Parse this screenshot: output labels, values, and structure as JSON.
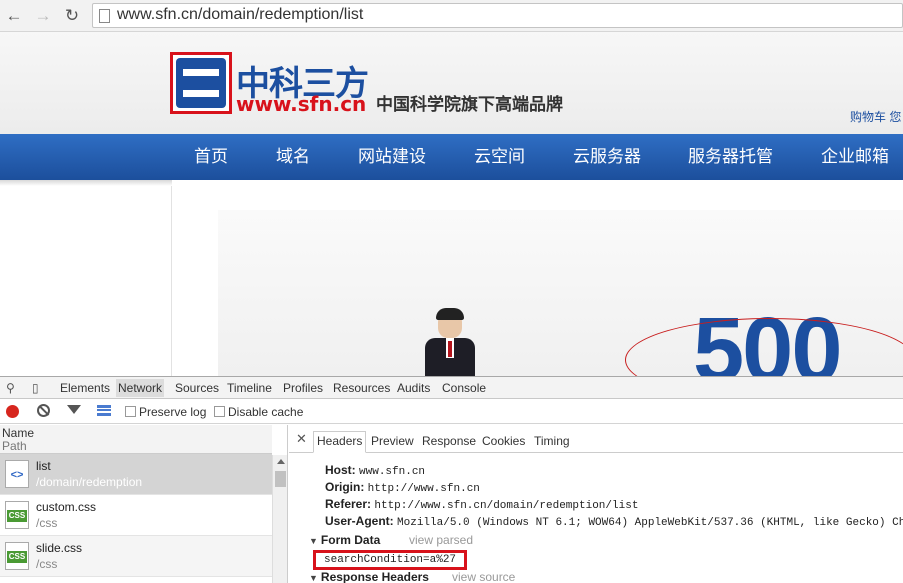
{
  "browser": {
    "url": "www.sfn.cn/domain/redemption/list"
  },
  "site": {
    "logo_text_cn": "中科三方",
    "logo_url": "www.sfn.cn",
    "slogan": "中国科学院旗下高端品牌",
    "cart_link": "购物车 您",
    "nav": [
      "首页",
      "域名",
      "网站建设",
      "云空间",
      "云服务器",
      "服务器托管",
      "企业邮箱"
    ],
    "banner_text": "500",
    "brand_colors": {
      "blue": "#1c4fa0",
      "red": "#d8121b"
    }
  },
  "devtools": {
    "tabs": [
      "Elements",
      "Network",
      "Sources",
      "Timeline",
      "Profiles",
      "Resources",
      "Audits",
      "Console"
    ],
    "active_tab": "Network",
    "toolbar": {
      "preserve_log": "Preserve log",
      "disable_cache": "Disable cache"
    },
    "list_header": {
      "name": "Name",
      "path": "Path"
    },
    "requests": [
      {
        "name": "list",
        "path": "/domain/redemption",
        "type": "html",
        "icon_text": "<>"
      },
      {
        "name": "custom.css",
        "path": "/css",
        "type": "css",
        "icon_text": "CSS"
      },
      {
        "name": "slide.css",
        "path": "/css",
        "type": "css",
        "icon_text": "CSS"
      }
    ],
    "detail_tabs": [
      "Headers",
      "Preview",
      "Response",
      "Cookies",
      "Timing"
    ],
    "active_detail_tab": "Headers",
    "request_headers": [
      {
        "key": "Host:",
        "value": "www.sfn.cn"
      },
      {
        "key": "Origin:",
        "value": "http://www.sfn.cn"
      },
      {
        "key": "Referer:",
        "value": "http://www.sfn.cn/domain/redemption/list"
      },
      {
        "key": "User-Agent:",
        "value": "Mozilla/5.0 (Windows NT 6.1; WOW64) AppleWebKit/537.36 (KHTML, like Gecko) Ch"
      }
    ],
    "form_data": {
      "title": "Form Data",
      "link": "view parsed",
      "value": "searchCondition=a%27"
    },
    "response_headers": {
      "title": "Response Headers",
      "link": "view source"
    }
  }
}
